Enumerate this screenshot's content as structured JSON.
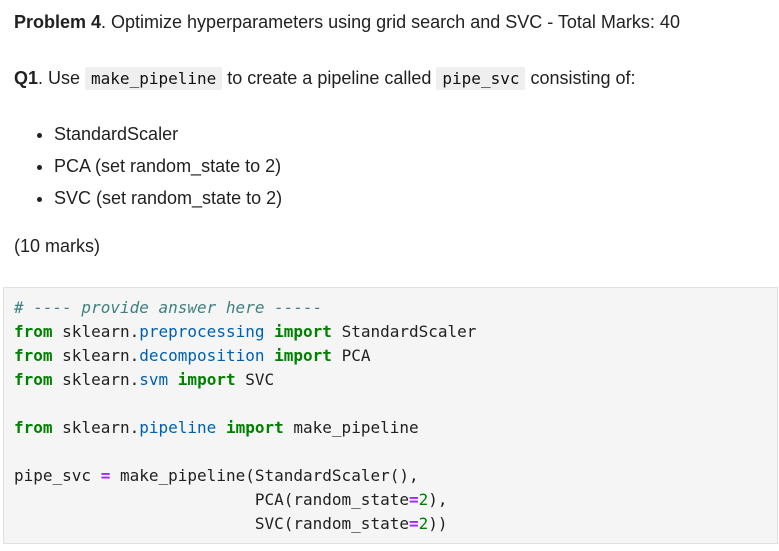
{
  "problem": {
    "bold": "Problem 4",
    "text": ". Optimize hyperparameters using grid search and SVC - Total Marks: 40"
  },
  "q1": {
    "bold": "Q1",
    "text_before": ". Use ",
    "code1": "make_pipeline",
    "text_middle": " to create a pipeline called ",
    "code2": "pipe_svc",
    "text_after": " consisting of:"
  },
  "bullets": [
    "StandardScaler",
    "PCA (set random_state to 2)",
    "SVC (set random_state to 2)"
  ],
  "marks": "(10 marks)",
  "code": {
    "comment": "# ---- provide answer here -----",
    "kw_from": "from",
    "kw_import": "import",
    "pkg": "sklearn",
    "dot": ".",
    "mod1": "preprocessing",
    "imp1": "StandardScaler",
    "mod2": "decomposition",
    "imp2": "PCA",
    "mod3": "svm",
    "imp3": "SVC",
    "mod4": "pipeline",
    "imp4": "make_pipeline",
    "assign_var": "pipe_svc",
    "eq": "=",
    "call_fn": "make_pipeline",
    "lparen": "(",
    "rparen": ")",
    "arg1": "StandardScaler()",
    "comma": ",",
    "arg2_fn": "PCA",
    "arg3_fn": "SVC",
    "param": "random_state",
    "param_eq": "=",
    "param_val": "2"
  }
}
